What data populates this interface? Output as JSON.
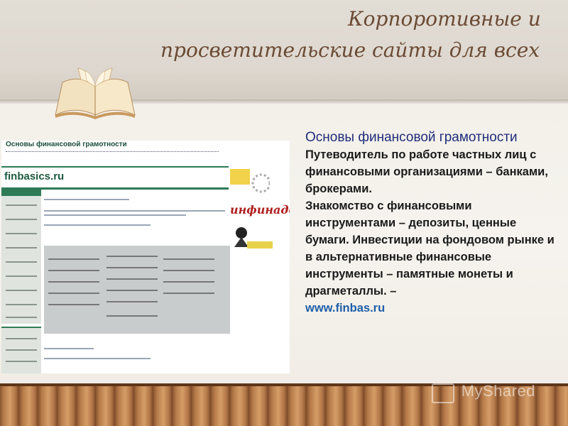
{
  "slide": {
    "title_line1": "Корпоротивные и",
    "title_line2": "просветительские сайты для всех"
  },
  "screenshot": {
    "site_title": "Основы финансовой грамотности",
    "logo_text": "finbasics.ru",
    "ad_text": "инфинадо"
  },
  "content": {
    "heading": "Основы финансовой грамотности",
    "paragraphs": [
      "Путеводитель по работе частных лиц с финансовыми организациями – банками, брокерами.",
      "Знакомство с финансовыми инструментами – депозиты, ценные бумаги. Инвестиции на фондовом рынке и в альтернативные финансовые инструменты – памятные монеты и драгметаллы. –"
    ],
    "url": "www.finbas.ru"
  },
  "watermark": {
    "text": "MyShared"
  }
}
